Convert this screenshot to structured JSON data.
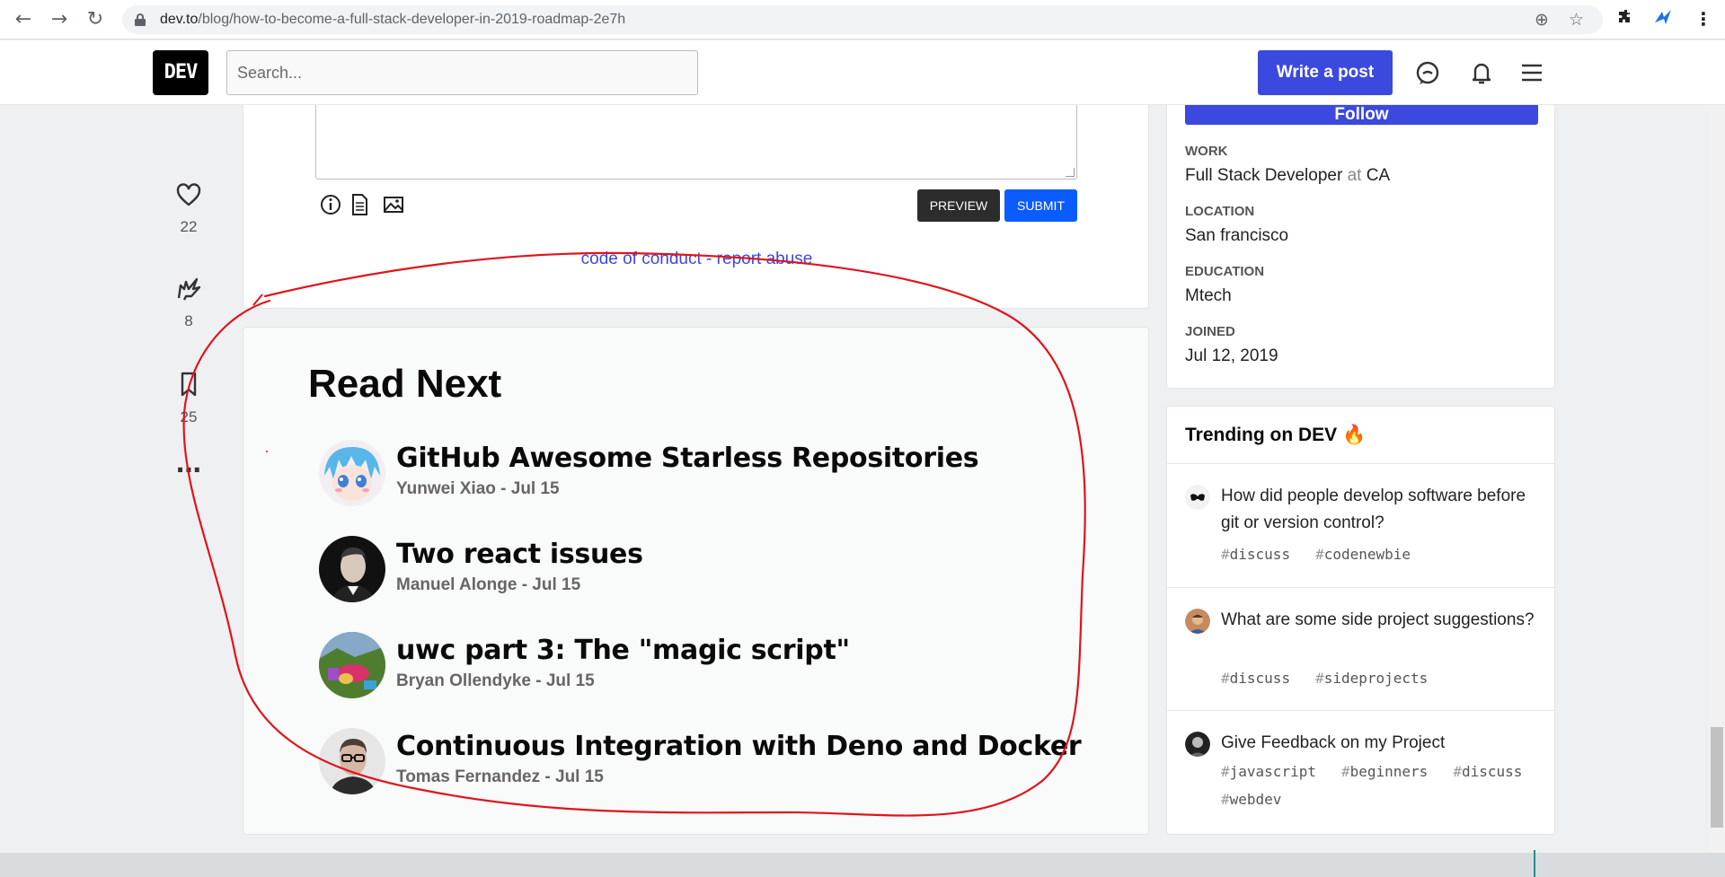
{
  "browser": {
    "url_host": "dev.to",
    "url_path": "/blog/how-to-become-a-full-stack-developer-in-2019-roadmap-2e7h"
  },
  "header": {
    "logo_text": "DEV",
    "search_placeholder": "Search...",
    "write_post_label": "Write a post"
  },
  "reactions": {
    "hearts": "22",
    "unicorns": "8",
    "bookmarks": "25"
  },
  "comment": {
    "preview_label": "PREVIEW",
    "submit_label": "SUBMIT",
    "code_of_conduct": "code of conduct",
    "separator": " - ",
    "report_abuse": "report abuse"
  },
  "read_next": {
    "heading": "Read Next",
    "items": [
      {
        "title": "GitHub Awesome Starless Repositories",
        "meta": "Yunwei Xiao - Jul 15"
      },
      {
        "title": "Two react issues",
        "meta": "Manuel Alonge - Jul 15"
      },
      {
        "title": "uwc part 3: The \"magic script\"",
        "meta": "Bryan Ollendyke - Jul 15"
      },
      {
        "title": "Continuous Integration with Deno and Docker",
        "meta": "Tomas Fernandez - Jul 15"
      }
    ]
  },
  "profile": {
    "follow_label": "Follow",
    "work_label": "WORK",
    "work_title": "Full Stack Developer",
    "work_at": "at",
    "work_company": "CA",
    "location_label": "LOCATION",
    "location_value": "San francisco",
    "education_label": "EDUCATION",
    "education_value": "Mtech",
    "joined_label": "JOINED",
    "joined_value": "Jul 12, 2019"
  },
  "trending": {
    "heading": "Trending on DEV 🔥",
    "items": [
      {
        "title": "How did people develop software before git or version control?",
        "tags": [
          "discuss",
          "codenewbie"
        ]
      },
      {
        "title": "What are some side project suggestions?",
        "tags": [
          "discuss",
          "sideprojects"
        ]
      },
      {
        "title": "Give Feedback on my Project",
        "tags": [
          "javascript",
          "beginners",
          "discuss",
          "webdev"
        ]
      }
    ]
  },
  "colors": {
    "accent": "#3b49df",
    "submit": "#0b5cff",
    "annotation": "#e0141b"
  }
}
